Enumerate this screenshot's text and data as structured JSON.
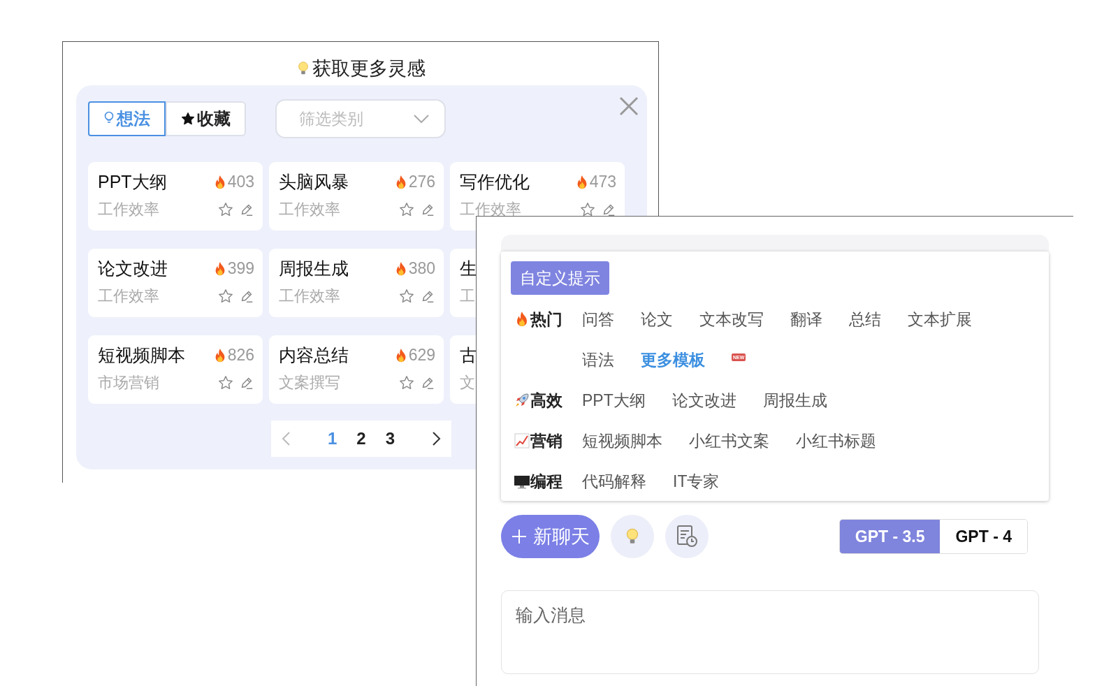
{
  "inspiration_window": {
    "title": "获取更多灵感",
    "tabs": [
      {
        "label": "想法",
        "selected": true
      },
      {
        "label": "收藏",
        "selected": false
      }
    ],
    "filter": {
      "placeholder": "筛选类别"
    },
    "cards": [
      {
        "title": "PPT大纲",
        "count": "403",
        "category": "工作效率"
      },
      {
        "title": "头脑风暴",
        "count": "276",
        "category": "工作效率"
      },
      {
        "title": "写作优化",
        "count": "473",
        "category": "工作效率"
      },
      {
        "title": "论文改进",
        "count": "399",
        "category": "工作效率"
      },
      {
        "title": "周报生成",
        "count": "380",
        "category": "工作效率"
      },
      {
        "title": "生",
        "category": "工"
      },
      {
        "title": "短视频脚本",
        "count": "826",
        "category": "市场营销"
      },
      {
        "title": "内容总结",
        "count": "629",
        "category": "文案撰写"
      },
      {
        "title": "古",
        "category": "文"
      }
    ],
    "pagination": {
      "pages": [
        {
          "label": "1",
          "selected": true
        },
        {
          "label": "2",
          "selected": false
        },
        {
          "label": "3",
          "selected": false
        }
      ]
    }
  },
  "prompt_panel": {
    "custom_prompt_button": "自定义提示",
    "categories": [
      {
        "label": "热门",
        "kind": "fire",
        "items": [
          {
            "label": "问答",
            "kind": "template"
          },
          {
            "label": "论文",
            "kind": "template"
          },
          {
            "label": "文本改写",
            "kind": "template"
          },
          {
            "label": "翻译",
            "kind": "template"
          },
          {
            "label": "总结",
            "kind": "template"
          },
          {
            "label": "文本扩展",
            "kind": "template"
          },
          {
            "label": "语法",
            "kind": "template"
          },
          {
            "label": "更多模板",
            "kind": "link",
            "badge": "NEW"
          }
        ]
      },
      {
        "label": "高效",
        "kind": "rocket",
        "items": [
          {
            "label": "PPT大纲",
            "kind": "template"
          },
          {
            "label": "论文改进",
            "kind": "template"
          },
          {
            "label": "周报生成",
            "kind": "template"
          }
        ]
      },
      {
        "label": "营销",
        "kind": "chart",
        "items": [
          {
            "label": "短视频脚本",
            "kind": "template"
          },
          {
            "label": "小红书文案",
            "kind": "template"
          },
          {
            "label": "小红书标题",
            "kind": "template"
          }
        ]
      },
      {
        "label": "编程",
        "kind": "monitor",
        "items": [
          {
            "label": "代码解释",
            "kind": "template"
          },
          {
            "label": "IT专家",
            "kind": "template"
          }
        ]
      }
    ],
    "new_chat_button": "新聊天",
    "models": [
      {
        "label": "GPT - 3.5",
        "selected": true
      },
      {
        "label": "GPT - 4",
        "selected": false
      }
    ],
    "message_input": {
      "placeholder": "输入消息"
    }
  }
}
